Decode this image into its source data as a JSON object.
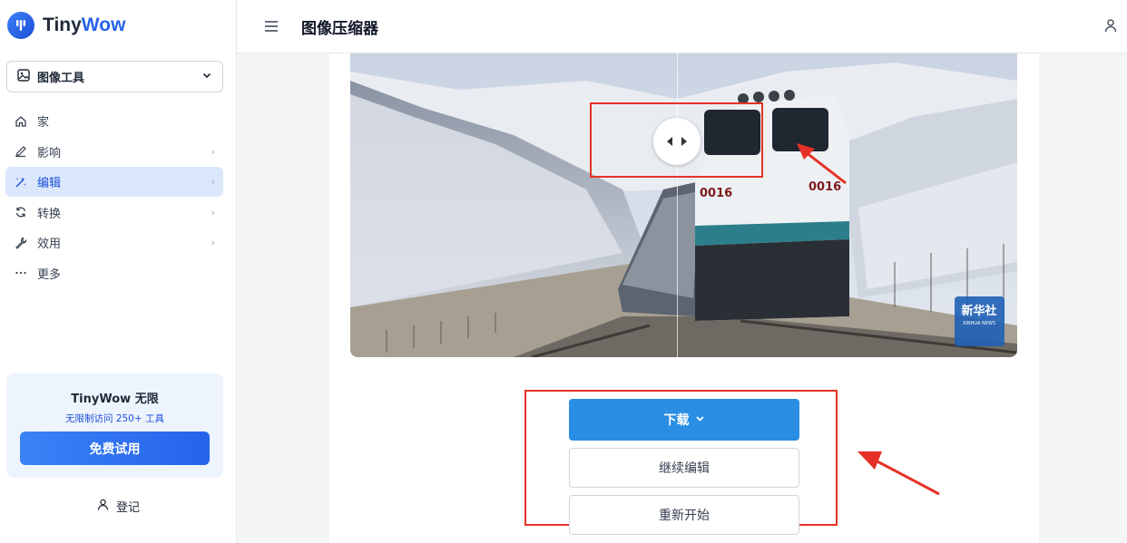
{
  "app": {
    "brand_part1": "Tiny",
    "brand_part2": "Wow",
    "page_title": "图像压缩器"
  },
  "sidebar": {
    "tool_select": {
      "label": "图像工具"
    },
    "items": [
      {
        "label": "家",
        "icon": "home-icon",
        "has_children": false,
        "active": false
      },
      {
        "label": "影响",
        "icon": "pencil-icon",
        "has_children": true,
        "active": false
      },
      {
        "label": "编辑",
        "icon": "magic-wand-icon",
        "has_children": true,
        "active": true
      },
      {
        "label": "转换",
        "icon": "refresh-icon",
        "has_children": true,
        "active": false
      },
      {
        "label": "效用",
        "icon": "wrench-icon",
        "has_children": true,
        "active": false
      },
      {
        "label": "更多",
        "icon": "more-icon",
        "has_children": false,
        "active": false
      }
    ],
    "promo": {
      "title": "TinyWow 无限",
      "subtitle": "无限制访问 250+ 工具",
      "button": "免费试用"
    },
    "login_label": "登记"
  },
  "image": {
    "train_number_left": "0016",
    "train_number_right": "0016",
    "watermark": "新华社",
    "watermark_sub": "XINHUA NEWS"
  },
  "actions": {
    "download": "下载",
    "continue_edit": "继续编辑",
    "restart": "重新开始"
  },
  "colors": {
    "accent": "#2a8ee4",
    "active_bg": "#dbe8fb",
    "annotation": "#e63226"
  }
}
